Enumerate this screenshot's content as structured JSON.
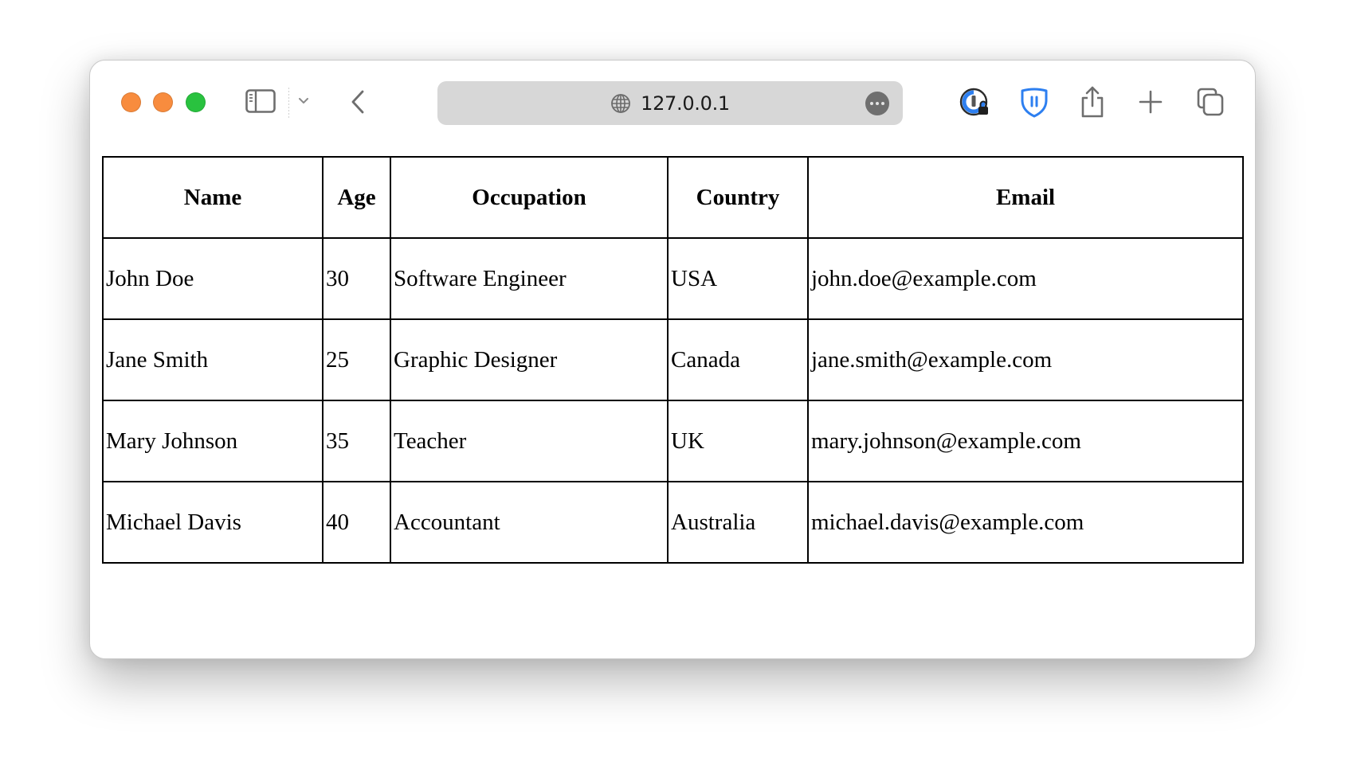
{
  "browser": {
    "traffic_lights": {
      "close_color": "#f88c3e",
      "minimize_color": "#f88c3e",
      "maximize_color": "#29c23f"
    },
    "icons": {
      "sidebar": "sidebar-icon",
      "sidebar_menu": "chevron-down-icon",
      "back": "chevron-left-icon",
      "site": "globe-icon",
      "page_menu": "ellipsis-circle-icon",
      "password_manager": "onepassword-icon",
      "bitwarden": "bitwarden-shield-icon",
      "share": "share-icon",
      "new_tab": "plus-icon",
      "tab_overview": "tabs-overview-icon"
    },
    "address_bar": {
      "url": "127.0.0.1"
    },
    "accent_color": "#2d7ff0"
  },
  "table": {
    "headers": [
      "Name",
      "Age",
      "Occupation",
      "Country",
      "Email"
    ],
    "rows": [
      [
        "John Doe",
        "30",
        "Software Engineer",
        "USA",
        "john.doe@example.com"
      ],
      [
        "Jane Smith",
        "25",
        "Graphic Designer",
        "Canada",
        "jane.smith@example.com"
      ],
      [
        "Mary Johnson",
        "35",
        "Teacher",
        "UK",
        "mary.johnson@example.com"
      ],
      [
        "Michael Davis",
        "40",
        "Accountant",
        "Australia",
        "michael.davis@example.com"
      ]
    ]
  }
}
